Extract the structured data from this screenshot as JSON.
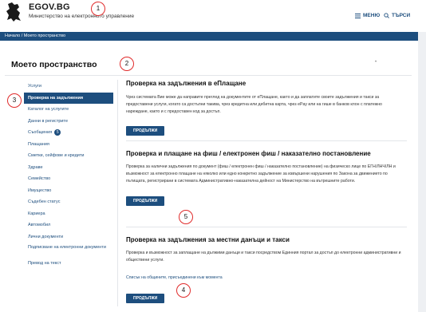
{
  "header": {
    "site_title": "EGOV.BG",
    "site_subtitle": "Министерство на електронното управление",
    "menu_label": "МЕНЮ",
    "search_label": "ТЪРСИ"
  },
  "breadcrumb": "Начало / Моето пространство",
  "page_title": "Моето пространство",
  "sidebar": {
    "items": [
      {
        "label": "Услуги"
      },
      {
        "label": "Проверка на задължения"
      },
      {
        "label": "Каталог на услугите"
      },
      {
        "label": "Данни в регистрите"
      },
      {
        "label": "Съобщения",
        "badge": "5"
      },
      {
        "label": "Плащания"
      },
      {
        "label": "Сметки, сейфове и кредити"
      },
      {
        "label": "Здраве"
      },
      {
        "label": "Семейство"
      },
      {
        "label": "Имущество"
      },
      {
        "label": "Съдебен статус"
      },
      {
        "label": "Кариера"
      },
      {
        "label": "Автомобил"
      },
      {
        "label": "Лични документи"
      },
      {
        "label": "Подписване на електронни документи"
      },
      {
        "label": "Превод на текст"
      }
    ]
  },
  "sections": [
    {
      "title": "Проверка на задължения в еПлащане",
      "text": "Чрез системата Вие може да направите преглед на документите от еПлащане, както и да заплатите своите задължения и такси за предоставени услуги, когато са достъпни такива, чрез кредитна или дебитна карта, чрез еPay или на гише в банков клон с платежно нареждане, както и с предоставен код за достъп.",
      "button": "ПРОДЪЛЖИ"
    },
    {
      "title": "Проверка и плащане на фиш / електронен фиш / наказателно постановление",
      "text": "Проверка за налични задължения по документ (фиш / електронен фиш / наказателно постановление) на физическо лице по ЕГН/ЛНЧ/ЛН и възможност за електронно плащане на няколко или едно конкретно задължение за извършени нарушения по Закона за движението по пътищата, регистрирани в системата Административно-наказателна дейност на Министерство на вътрешните работи.",
      "button": "ПРОДЪЛЖИ"
    },
    {
      "title": "Проверка на задължения за местни данъци и такси",
      "text": "Проверка и възможност за заплащане на дължими данъци и такси посредством Единния портал за достъп до електронни административни и обществени услуги.",
      "link": "Списък на общините, присъединени към момента",
      "button": "ПРОДЪЛЖИ"
    }
  ],
  "annotations": [
    "1",
    "2",
    "3",
    "4",
    "5"
  ],
  "colors": {
    "accent": "#1d4e7e",
    "annotation": "#e02b2b"
  },
  "icons": {
    "logo": "bulgarian-lion-icon",
    "menu": "hamburger-icon",
    "search": "magnifier-icon"
  }
}
